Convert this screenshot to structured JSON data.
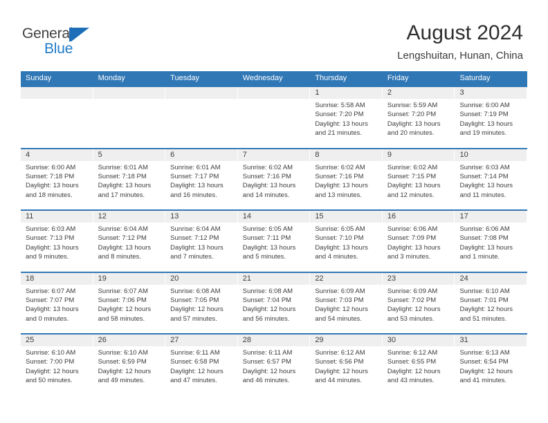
{
  "brand": {
    "name_part1": "General",
    "name_part2": "Blue",
    "mark": "flag-triangle-icon",
    "accent_color": "#1e7bc8"
  },
  "header": {
    "title": "August 2024",
    "subtitle": "Lengshuitan, Hunan, China"
  },
  "theme": {
    "header_blue": "#3077b6",
    "day_band_gray": "#efefef",
    "text_color": "#3c3c3c"
  },
  "weekdays": [
    "Sunday",
    "Monday",
    "Tuesday",
    "Wednesday",
    "Thursday",
    "Friday",
    "Saturday"
  ],
  "weeks": [
    [
      {
        "day": "",
        "lines": []
      },
      {
        "day": "",
        "lines": []
      },
      {
        "day": "",
        "lines": []
      },
      {
        "day": "",
        "lines": []
      },
      {
        "day": "1",
        "lines": [
          "Sunrise: 5:58 AM",
          "Sunset: 7:20 PM",
          "Daylight: 13 hours",
          "and 21 minutes."
        ]
      },
      {
        "day": "2",
        "lines": [
          "Sunrise: 5:59 AM",
          "Sunset: 7:20 PM",
          "Daylight: 13 hours",
          "and 20 minutes."
        ]
      },
      {
        "day": "3",
        "lines": [
          "Sunrise: 6:00 AM",
          "Sunset: 7:19 PM",
          "Daylight: 13 hours",
          "and 19 minutes."
        ]
      }
    ],
    [
      {
        "day": "4",
        "lines": [
          "Sunrise: 6:00 AM",
          "Sunset: 7:18 PM",
          "Daylight: 13 hours",
          "and 18 minutes."
        ]
      },
      {
        "day": "5",
        "lines": [
          "Sunrise: 6:01 AM",
          "Sunset: 7:18 PM",
          "Daylight: 13 hours",
          "and 17 minutes."
        ]
      },
      {
        "day": "6",
        "lines": [
          "Sunrise: 6:01 AM",
          "Sunset: 7:17 PM",
          "Daylight: 13 hours",
          "and 16 minutes."
        ]
      },
      {
        "day": "7",
        "lines": [
          "Sunrise: 6:02 AM",
          "Sunset: 7:16 PM",
          "Daylight: 13 hours",
          "and 14 minutes."
        ]
      },
      {
        "day": "8",
        "lines": [
          "Sunrise: 6:02 AM",
          "Sunset: 7:16 PM",
          "Daylight: 13 hours",
          "and 13 minutes."
        ]
      },
      {
        "day": "9",
        "lines": [
          "Sunrise: 6:02 AM",
          "Sunset: 7:15 PM",
          "Daylight: 13 hours",
          "and 12 minutes."
        ]
      },
      {
        "day": "10",
        "lines": [
          "Sunrise: 6:03 AM",
          "Sunset: 7:14 PM",
          "Daylight: 13 hours",
          "and 11 minutes."
        ]
      }
    ],
    [
      {
        "day": "11",
        "lines": [
          "Sunrise: 6:03 AM",
          "Sunset: 7:13 PM",
          "Daylight: 13 hours",
          "and 9 minutes."
        ]
      },
      {
        "day": "12",
        "lines": [
          "Sunrise: 6:04 AM",
          "Sunset: 7:12 PM",
          "Daylight: 13 hours",
          "and 8 minutes."
        ]
      },
      {
        "day": "13",
        "lines": [
          "Sunrise: 6:04 AM",
          "Sunset: 7:12 PM",
          "Daylight: 13 hours",
          "and 7 minutes."
        ]
      },
      {
        "day": "14",
        "lines": [
          "Sunrise: 6:05 AM",
          "Sunset: 7:11 PM",
          "Daylight: 13 hours",
          "and 5 minutes."
        ]
      },
      {
        "day": "15",
        "lines": [
          "Sunrise: 6:05 AM",
          "Sunset: 7:10 PM",
          "Daylight: 13 hours",
          "and 4 minutes."
        ]
      },
      {
        "day": "16",
        "lines": [
          "Sunrise: 6:06 AM",
          "Sunset: 7:09 PM",
          "Daylight: 13 hours",
          "and 3 minutes."
        ]
      },
      {
        "day": "17",
        "lines": [
          "Sunrise: 6:06 AM",
          "Sunset: 7:08 PM",
          "Daylight: 13 hours",
          "and 1 minute."
        ]
      }
    ],
    [
      {
        "day": "18",
        "lines": [
          "Sunrise: 6:07 AM",
          "Sunset: 7:07 PM",
          "Daylight: 13 hours",
          "and 0 minutes."
        ]
      },
      {
        "day": "19",
        "lines": [
          "Sunrise: 6:07 AM",
          "Sunset: 7:06 PM",
          "Daylight: 12 hours",
          "and 58 minutes."
        ]
      },
      {
        "day": "20",
        "lines": [
          "Sunrise: 6:08 AM",
          "Sunset: 7:05 PM",
          "Daylight: 12 hours",
          "and 57 minutes."
        ]
      },
      {
        "day": "21",
        "lines": [
          "Sunrise: 6:08 AM",
          "Sunset: 7:04 PM",
          "Daylight: 12 hours",
          "and 56 minutes."
        ]
      },
      {
        "day": "22",
        "lines": [
          "Sunrise: 6:09 AM",
          "Sunset: 7:03 PM",
          "Daylight: 12 hours",
          "and 54 minutes."
        ]
      },
      {
        "day": "23",
        "lines": [
          "Sunrise: 6:09 AM",
          "Sunset: 7:02 PM",
          "Daylight: 12 hours",
          "and 53 minutes."
        ]
      },
      {
        "day": "24",
        "lines": [
          "Sunrise: 6:10 AM",
          "Sunset: 7:01 PM",
          "Daylight: 12 hours",
          "and 51 minutes."
        ]
      }
    ],
    [
      {
        "day": "25",
        "lines": [
          "Sunrise: 6:10 AM",
          "Sunset: 7:00 PM",
          "Daylight: 12 hours",
          "and 50 minutes."
        ]
      },
      {
        "day": "26",
        "lines": [
          "Sunrise: 6:10 AM",
          "Sunset: 6:59 PM",
          "Daylight: 12 hours",
          "and 49 minutes."
        ]
      },
      {
        "day": "27",
        "lines": [
          "Sunrise: 6:11 AM",
          "Sunset: 6:58 PM",
          "Daylight: 12 hours",
          "and 47 minutes."
        ]
      },
      {
        "day": "28",
        "lines": [
          "Sunrise: 6:11 AM",
          "Sunset: 6:57 PM",
          "Daylight: 12 hours",
          "and 46 minutes."
        ]
      },
      {
        "day": "29",
        "lines": [
          "Sunrise: 6:12 AM",
          "Sunset: 6:56 PM",
          "Daylight: 12 hours",
          "and 44 minutes."
        ]
      },
      {
        "day": "30",
        "lines": [
          "Sunrise: 6:12 AM",
          "Sunset: 6:55 PM",
          "Daylight: 12 hours",
          "and 43 minutes."
        ]
      },
      {
        "day": "31",
        "lines": [
          "Sunrise: 6:13 AM",
          "Sunset: 6:54 PM",
          "Daylight: 12 hours",
          "and 41 minutes."
        ]
      }
    ]
  ]
}
